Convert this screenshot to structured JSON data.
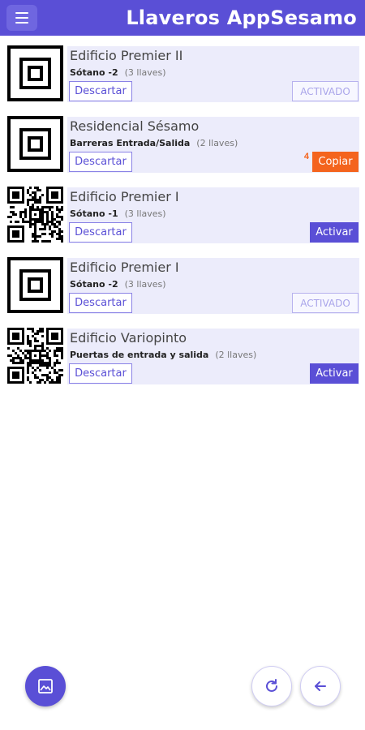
{
  "header": {
    "title": "Llaveros AppSesamo",
    "menu_icon": "menu-icon",
    "color": "#5a4fd6"
  },
  "keychains": [
    {
      "name": "Edificio Premier II",
      "location": "Sótano -2",
      "keys": "(3 llaves)",
      "thumb": "placeholder-qr",
      "discard_label": "Descartar",
      "action_label": "ACTIVADO",
      "action_type": "activated"
    },
    {
      "name": "Residencial Sésamo",
      "location": "Barreras Entrada/Salida",
      "keys": "(2 llaves)",
      "thumb": "placeholder-qr",
      "discard_label": "Descartar",
      "action_label": "Copiar",
      "action_type": "copy",
      "copy_count": "4"
    },
    {
      "name": "Edificio Premier I",
      "location": "Sótano -1",
      "keys": "(3 llaves)",
      "thumb": "qr-code",
      "discard_label": "Descartar",
      "action_label": "Activar",
      "action_type": "activate"
    },
    {
      "name": "Edificio Premier I",
      "location": "Sótano -2",
      "keys": "(3 llaves)",
      "thumb": "placeholder-qr",
      "discard_label": "Descartar",
      "action_label": "ACTIVADO",
      "action_type": "activated"
    },
    {
      "name": "Edificio Variopinto",
      "location": "Puertas de entrada y salida",
      "keys": "(2 llaves)",
      "thumb": "qr-code",
      "discard_label": "Descartar",
      "action_label": "Activar",
      "action_type": "activate"
    }
  ],
  "fabs": {
    "image": "image-icon",
    "refresh": "refresh-icon",
    "back": "arrow-left-icon"
  },
  "colors": {
    "accent": "#5a4fd6",
    "copy": "#f4641d",
    "card_bg": "#ececfb"
  }
}
